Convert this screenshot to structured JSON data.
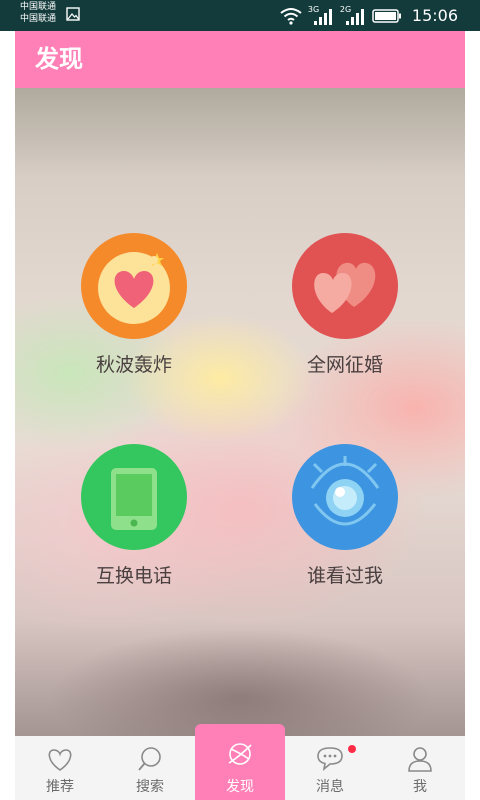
{
  "status_bar": {
    "carrier_1": "中国联通",
    "carrier_2": "中国联通",
    "net_1": "3G",
    "net_2": "2G",
    "time": "15:06"
  },
  "app_bar": {
    "title": "发现"
  },
  "features": [
    {
      "label": "秋波轰炸",
      "icon": "heart-burst-icon",
      "color": "#f48a2a"
    },
    {
      "label": "全网征婚",
      "icon": "two-hearts-icon",
      "color": "#e15253"
    },
    {
      "label": "互换电话",
      "icon": "phone-icon",
      "color": "#34c760"
    },
    {
      "label": "谁看过我",
      "icon": "eye-icon",
      "color": "#3d94e0"
    }
  ],
  "bottom_nav": [
    {
      "label": "推荐",
      "icon": "heart-outline-icon",
      "active": false
    },
    {
      "label": "搜索",
      "icon": "search-icon",
      "active": false
    },
    {
      "label": "发现",
      "icon": "discover-icon",
      "active": true
    },
    {
      "label": "消息",
      "icon": "chat-bubble-icon",
      "active": false,
      "badge": true
    },
    {
      "label": "我",
      "icon": "person-icon",
      "active": false
    }
  ],
  "colors": {
    "status_bar": "#143b3c",
    "accent_pink": "#ff80b7",
    "badge_red": "#ff2b45"
  }
}
